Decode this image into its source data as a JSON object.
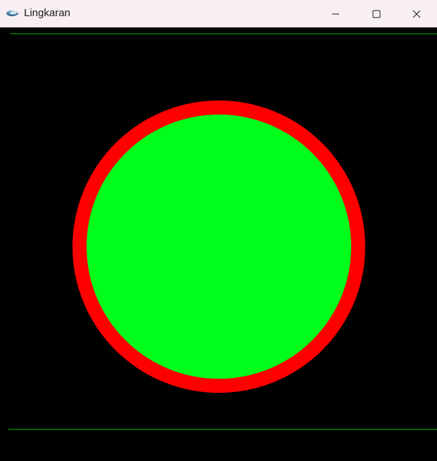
{
  "window": {
    "title": "Lingkaran",
    "icon": "app-icon",
    "controls": {
      "minimize": "minimize-icon",
      "maximize": "maximize-icon",
      "close": "close-icon"
    }
  },
  "canvas": {
    "background": "#000000",
    "outer_circle_color": "#ff0000",
    "inner_circle_color": "#00ff1a",
    "line_color": "#00c800"
  }
}
